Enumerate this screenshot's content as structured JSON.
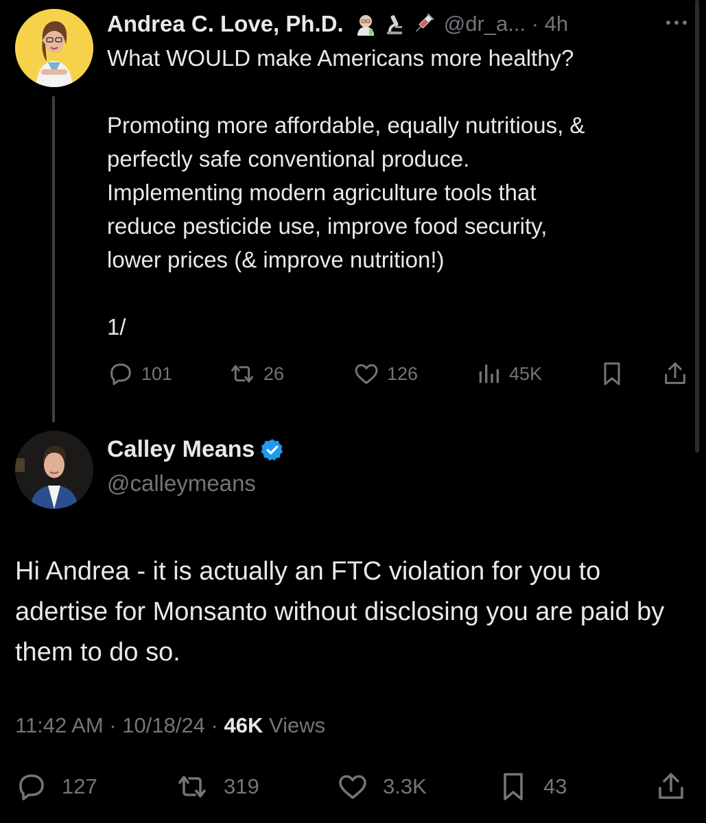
{
  "tweet1": {
    "author_name": "Andrea C. Love, Ph.D.",
    "author_emojis": [
      "scientist-emoji",
      "microscope-emoji",
      "syringe-emoji"
    ],
    "handle_time": "@dr_a... · 4h",
    "body_lines": [
      "What WOULD make Americans more healthy?",
      "",
      "Promoting more affordable, equally nutritious, &",
      "perfectly safe conventional produce.",
      "Implementing modern agriculture tools that",
      "reduce pesticide use, improve food security,",
      "lower prices (& improve nutrition!)",
      "",
      "1/"
    ],
    "actions": {
      "replies": "101",
      "reposts": "26",
      "likes": "126",
      "views": "45K"
    }
  },
  "tweet2": {
    "author_name": "Calley Means",
    "handle": "@calleymeans",
    "verified": true,
    "body": "Hi Andrea - it is actually an FTC violation for you to adertise for Monsanto without disclosing you are paid by them to do so.",
    "time": "11:42 AM",
    "date": "10/18/24",
    "views_count": "46K",
    "views_label": "Views",
    "actions": {
      "replies": "127",
      "reposts": "319",
      "likes": "3.3K",
      "bookmarks": "43"
    }
  },
  "colors": {
    "background": "#000000",
    "text": "#e7e9ea",
    "muted": "#71767b",
    "verified_blue": "#1d9bf0",
    "thread_line": "#3d4043"
  }
}
